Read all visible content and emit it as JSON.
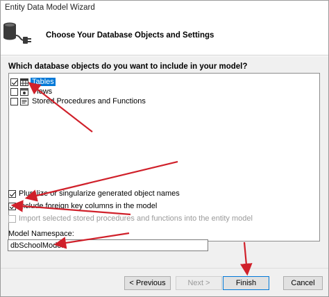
{
  "window": {
    "title": "Entity Data Model Wizard"
  },
  "header": {
    "heading": "Choose Your Database Objects and Settings",
    "icon": "database-plug-icon"
  },
  "main": {
    "question": "Which database objects do you want to include in your model?",
    "tree": [
      {
        "label": "Tables",
        "checked": true,
        "selected": true,
        "icon": "tables-icon"
      },
      {
        "label": "Views",
        "checked": false,
        "selected": false,
        "icon": "views-icon"
      },
      {
        "label": "Stored Procedures and Functions",
        "checked": false,
        "selected": false,
        "icon": "procedures-icon"
      }
    ],
    "options": {
      "pluralize": "Pluralize or singularize generated object names",
      "foreign_keys": "Include foreign key columns in the model",
      "import_procs": "Import selected stored procedures and functions into the entity model"
    },
    "namespace_label": "Model Namespace:",
    "namespace_value": "dbSchoolModel"
  },
  "footer": {
    "previous": "< Previous",
    "next": "Next >",
    "finish": "Finish",
    "cancel": "Cancel"
  },
  "colors": {
    "annotation_arrow": "#d0202a",
    "selection": "#0078d7"
  }
}
